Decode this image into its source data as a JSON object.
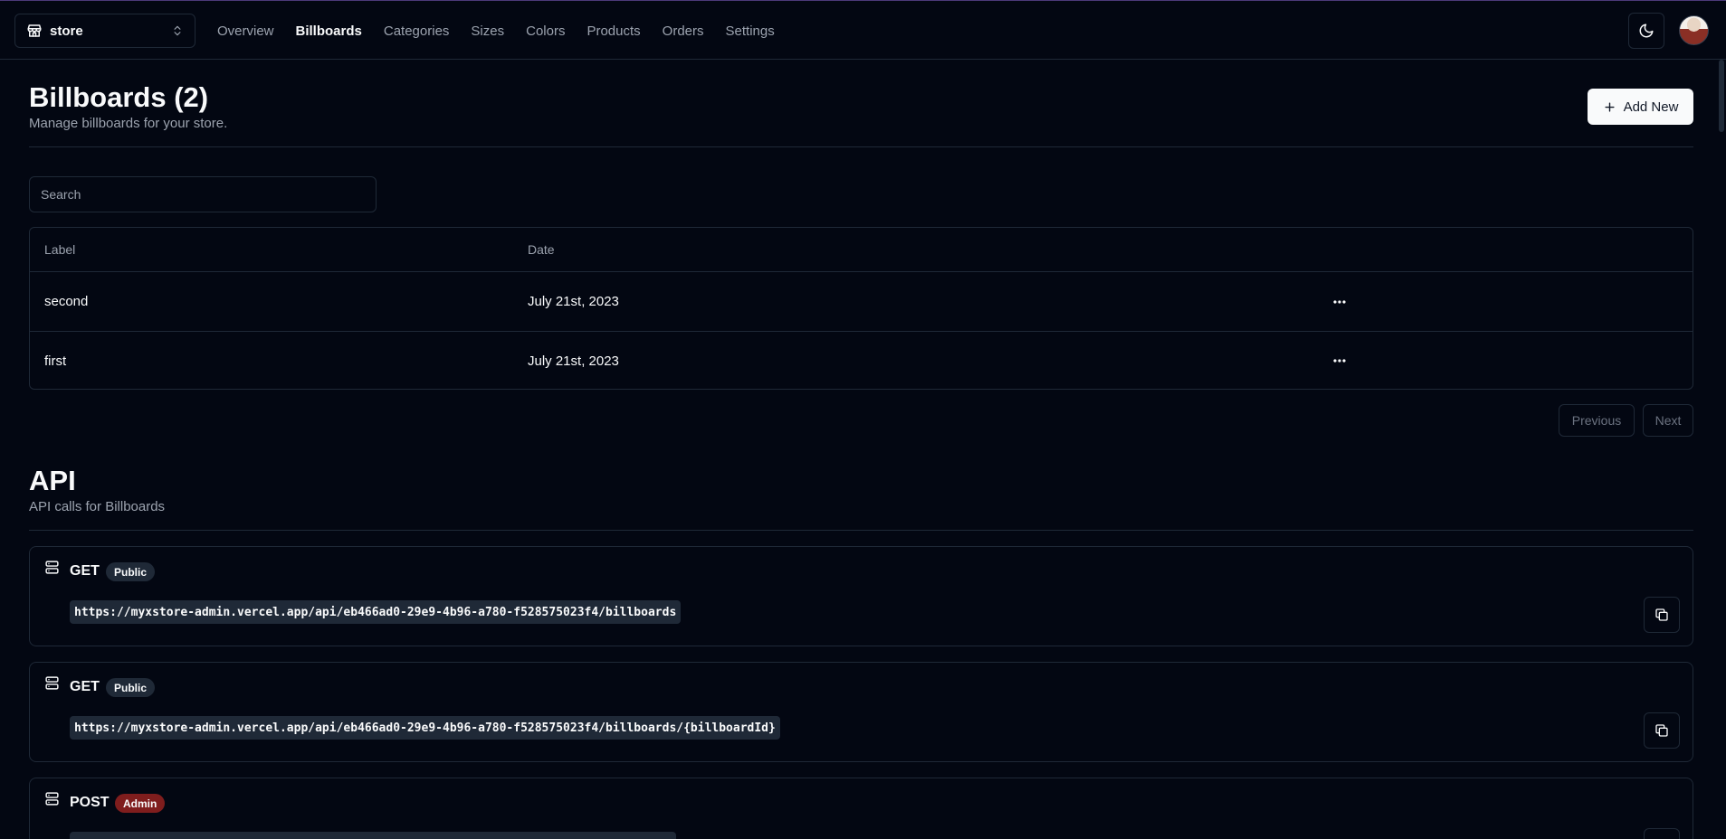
{
  "header": {
    "store_name": "store",
    "nav": [
      {
        "label": "Overview",
        "active": false
      },
      {
        "label": "Billboards",
        "active": true
      },
      {
        "label": "Categories",
        "active": false
      },
      {
        "label": "Sizes",
        "active": false
      },
      {
        "label": "Colors",
        "active": false
      },
      {
        "label": "Products",
        "active": false
      },
      {
        "label": "Orders",
        "active": false
      },
      {
        "label": "Settings",
        "active": false
      }
    ],
    "theme_icon": "moon-icon",
    "avatar_icon": "user-avatar"
  },
  "billboards": {
    "title": "Billboards (2)",
    "subtitle": "Manage billboards for your store.",
    "add_label": "Add New",
    "search_placeholder": "Search",
    "columns": [
      "Label",
      "Date"
    ],
    "rows": [
      {
        "label": "second",
        "date": "July 21st, 2023"
      },
      {
        "label": "first",
        "date": "July 21st, 2023"
      }
    ],
    "prev_label": "Previous",
    "next_label": "Next"
  },
  "api": {
    "title": "API",
    "subtitle": "API calls for Billboards",
    "endpoints": [
      {
        "method": "GET",
        "access": "Public",
        "url": "https://myxstore-admin.vercel.app/api/eb466ad0-29e9-4b96-a780-f528575023f4/billboards"
      },
      {
        "method": "GET",
        "access": "Public",
        "url": "https://myxstore-admin.vercel.app/api/eb466ad0-29e9-4b96-a780-f528575023f4/billboards/{billboardId}"
      },
      {
        "method": "POST",
        "access": "Admin",
        "url": ""
      }
    ]
  },
  "colors": {
    "background": "#030712",
    "border": "#1f2937",
    "muted_text": "#9ca3af",
    "admin_badge": "#7f1d1d"
  }
}
